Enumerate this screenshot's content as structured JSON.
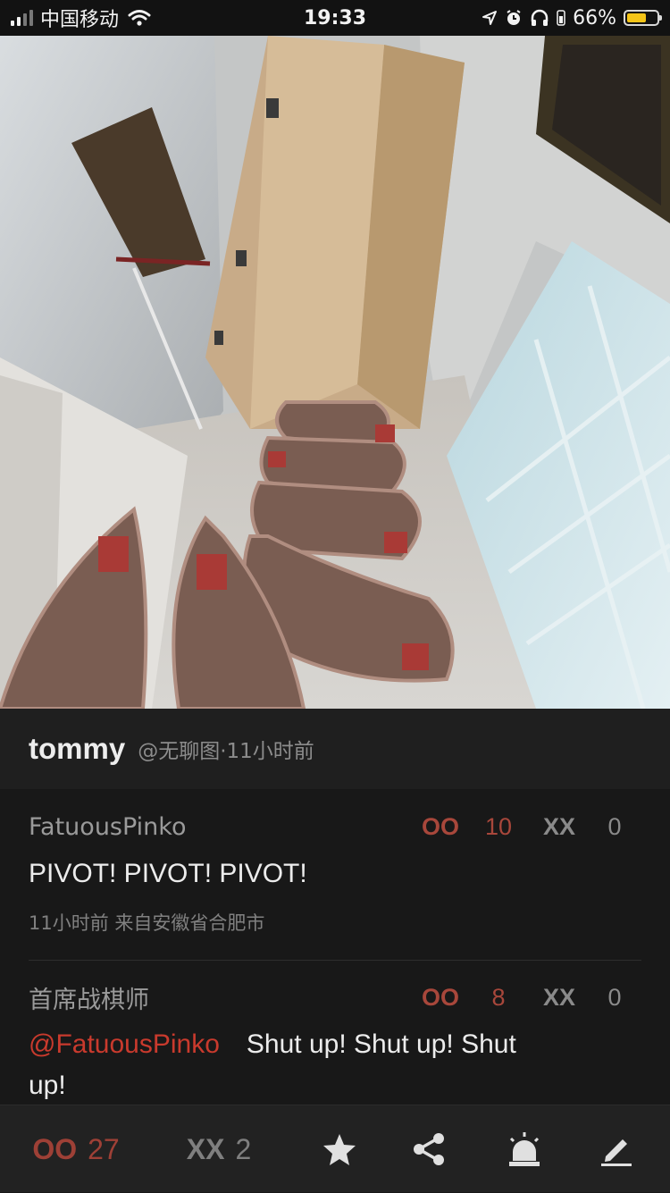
{
  "status_bar": {
    "carrier": "中国移动",
    "time": "19:33",
    "battery_percent": "66%",
    "battery_level": 0.66,
    "icons": [
      "signal-icon",
      "wifi-icon",
      "location-icon",
      "alarm-icon",
      "headphones-icon",
      "battery-icon"
    ]
  },
  "post": {
    "image_alt": "stairwell-photo",
    "author": "tommy",
    "meta": "@无聊图·11小时前"
  },
  "comments": [
    {
      "user": "FatuousPinko",
      "oo_label": "OO",
      "oo_count": "10",
      "xx_label": "XX",
      "xx_count": "0",
      "text": "PIVOT! PIVOT! PIVOT!",
      "meta": "11小时前 来自安徽省合肥市"
    },
    {
      "user": "首席战棋师",
      "oo_label": "OO",
      "oo_count": "8",
      "xx_label": "XX",
      "xx_count": "0",
      "mention": "@FatuousPinko",
      "text": "Shut up! Shut up! Shut up!"
    }
  ],
  "toolbar": {
    "oo_label": "OO",
    "oo_count": "27",
    "xx_label": "XX",
    "xx_count": "2",
    "icons": [
      "star-icon",
      "share-icon",
      "alarm-siren-icon",
      "edit-icon"
    ]
  },
  "colors": {
    "oo": "#a8473b",
    "mention": "#c93a2d",
    "battery": "#f5c518",
    "background": "#181818"
  }
}
